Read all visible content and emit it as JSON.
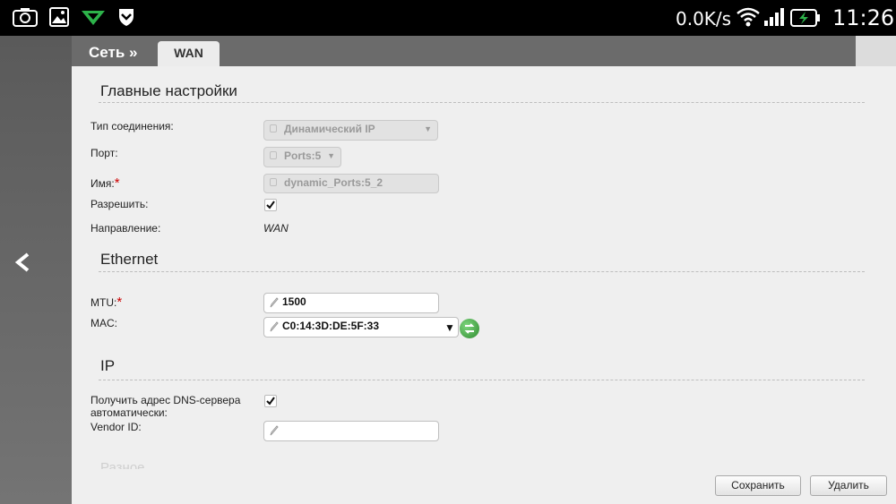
{
  "statusbar": {
    "speed": "0.0K/s",
    "time": "11:26"
  },
  "breadcrumb": {
    "label": "Сеть »"
  },
  "tab": {
    "label": "WAN"
  },
  "main_settings": {
    "title": "Главные настройки",
    "connection_type_label": "Тип соединения:",
    "connection_type_value": "Динамический IP",
    "port_label": "Порт:",
    "port_value": "Ports:5",
    "name_label": "Имя:",
    "name_value": "dynamic_Ports:5_2",
    "enable_label": "Разрешить:",
    "enable_checked": true,
    "direction_label": "Направление:",
    "direction_value": "WAN"
  },
  "ethernet": {
    "title": "Ethernet",
    "mtu_label": "MTU:",
    "mtu_value": "1500",
    "mac_label": "MAC:",
    "mac_value": "C0:14:3D:DE:5F:33"
  },
  "ip": {
    "title": "IP",
    "dns_label_line1": "Получить адрес DNS-сервера",
    "dns_label_line2": "автоматически:",
    "dns_checked": true,
    "vendor_label": "Vendor ID:",
    "vendor_value": ""
  },
  "partial_section": "Разное",
  "buttons": {
    "save": "Сохранить",
    "delete": "Удалить"
  }
}
